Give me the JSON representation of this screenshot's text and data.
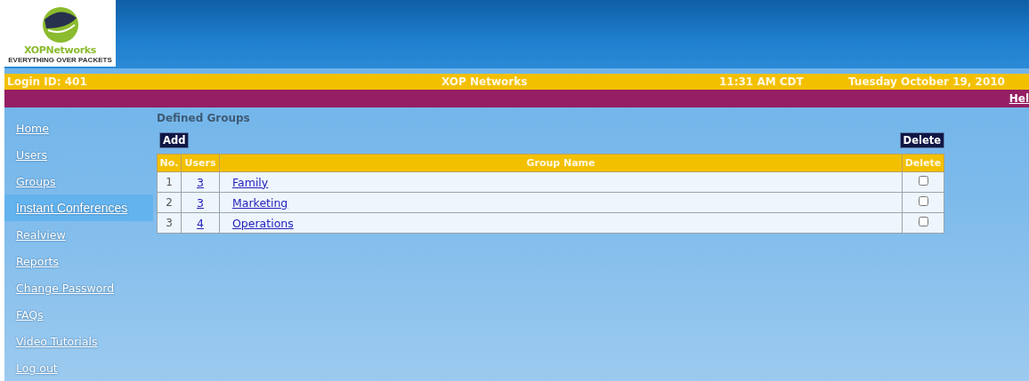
{
  "logo": {
    "name": "XOPNetworks",
    "tagline": "EVERYTHING OVER PACKETS"
  },
  "info_bar": {
    "login": "Login ID: 401",
    "company": "XOP Networks",
    "time": "11:31 AM CDT",
    "date": "Tuesday October 19, 2010"
  },
  "menu_bar": {
    "link": "Hel"
  },
  "sidebar": {
    "items": [
      {
        "label": "Home",
        "selected": false
      },
      {
        "label": "Users",
        "selected": false
      },
      {
        "label": "Groups",
        "selected": false
      },
      {
        "label": "Instant Conferences",
        "selected": true
      },
      {
        "label": "Realview",
        "selected": false
      },
      {
        "label": "Reports",
        "selected": false
      },
      {
        "label": "Change Password",
        "selected": false
      },
      {
        "label": "FAQs",
        "selected": false
      },
      {
        "label": "Video Tutorials",
        "selected": false
      },
      {
        "label": "Log out",
        "selected": false
      }
    ]
  },
  "content": {
    "title": "Defined Groups",
    "add_button": "Add",
    "delete_button": "Delete",
    "table": {
      "columns": [
        "No.",
        "Users",
        "Group Name",
        "Delete"
      ],
      "rows": [
        {
          "no": "1",
          "users": "3",
          "name": "Family",
          "checked": false
        },
        {
          "no": "2",
          "users": "3",
          "name": "Marketing",
          "checked": false
        },
        {
          "no": "3",
          "users": "4",
          "name": "Operations",
          "checked": false
        }
      ]
    }
  }
}
